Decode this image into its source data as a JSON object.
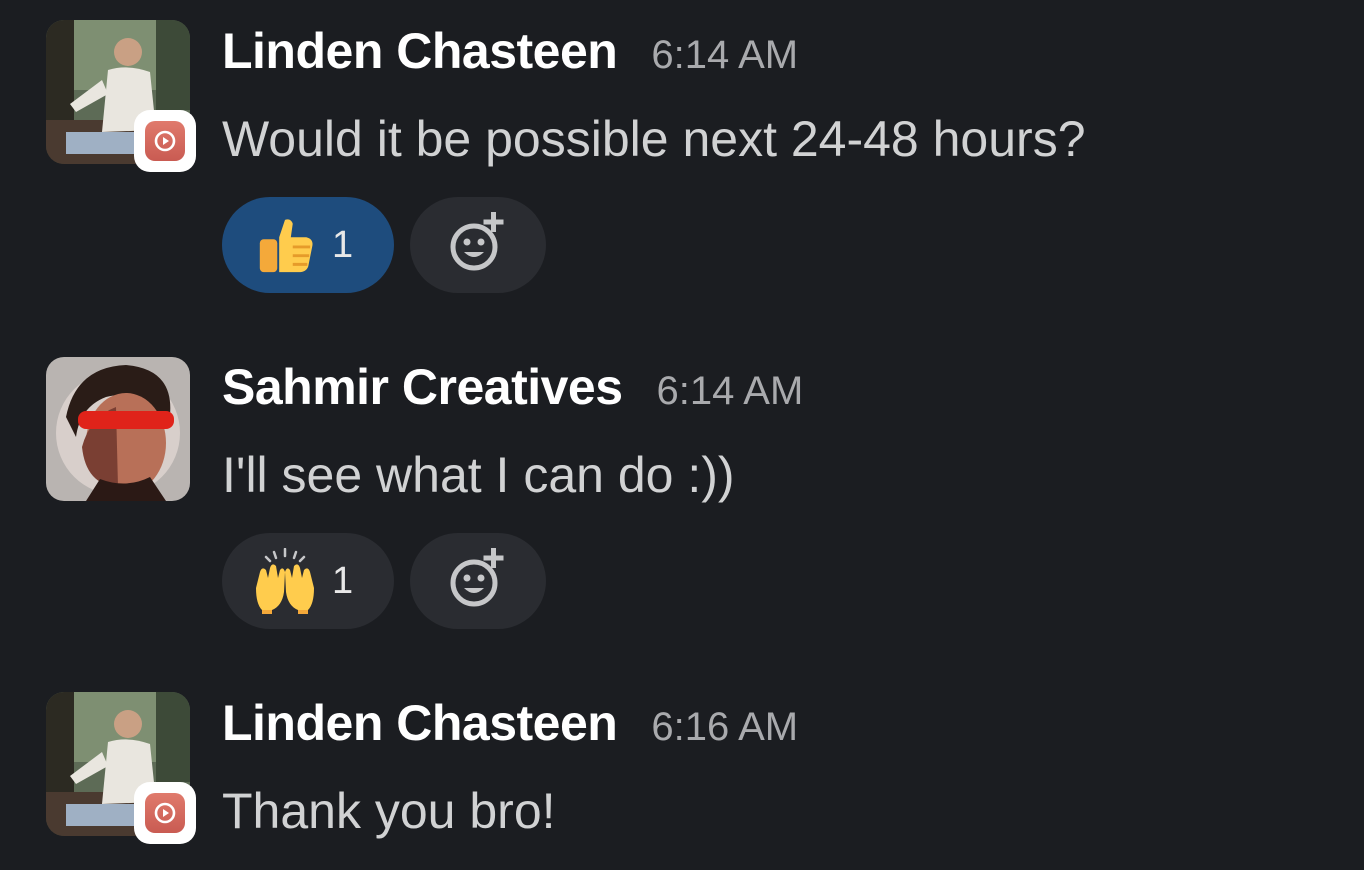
{
  "messages": [
    {
      "sender": "Linden Chasteen",
      "time": "6:14 AM",
      "text": "Would it be possible next 24-48 hours?",
      "has_app_badge": true,
      "reaction": {
        "emoji": "thumbs-up",
        "count": "1",
        "active": true
      }
    },
    {
      "sender": "Sahmir Creatives",
      "time": "6:14 AM",
      "text": "I'll see what I can do :))",
      "has_app_badge": false,
      "reaction": {
        "emoji": "raised-hands",
        "count": "1",
        "active": false
      }
    },
    {
      "sender": "Linden Chasteen",
      "time": "6:16 AM",
      "text": "Thank you bro!",
      "has_app_badge": true
    }
  ],
  "colors": {
    "background": "#1b1d21",
    "reaction_active": "#1e4c7d",
    "reaction_idle": "#2a2c31",
    "badge": "#c95b52"
  },
  "icons": {
    "add_reaction": "add-reaction-icon",
    "app_badge": "play-badge-icon"
  }
}
